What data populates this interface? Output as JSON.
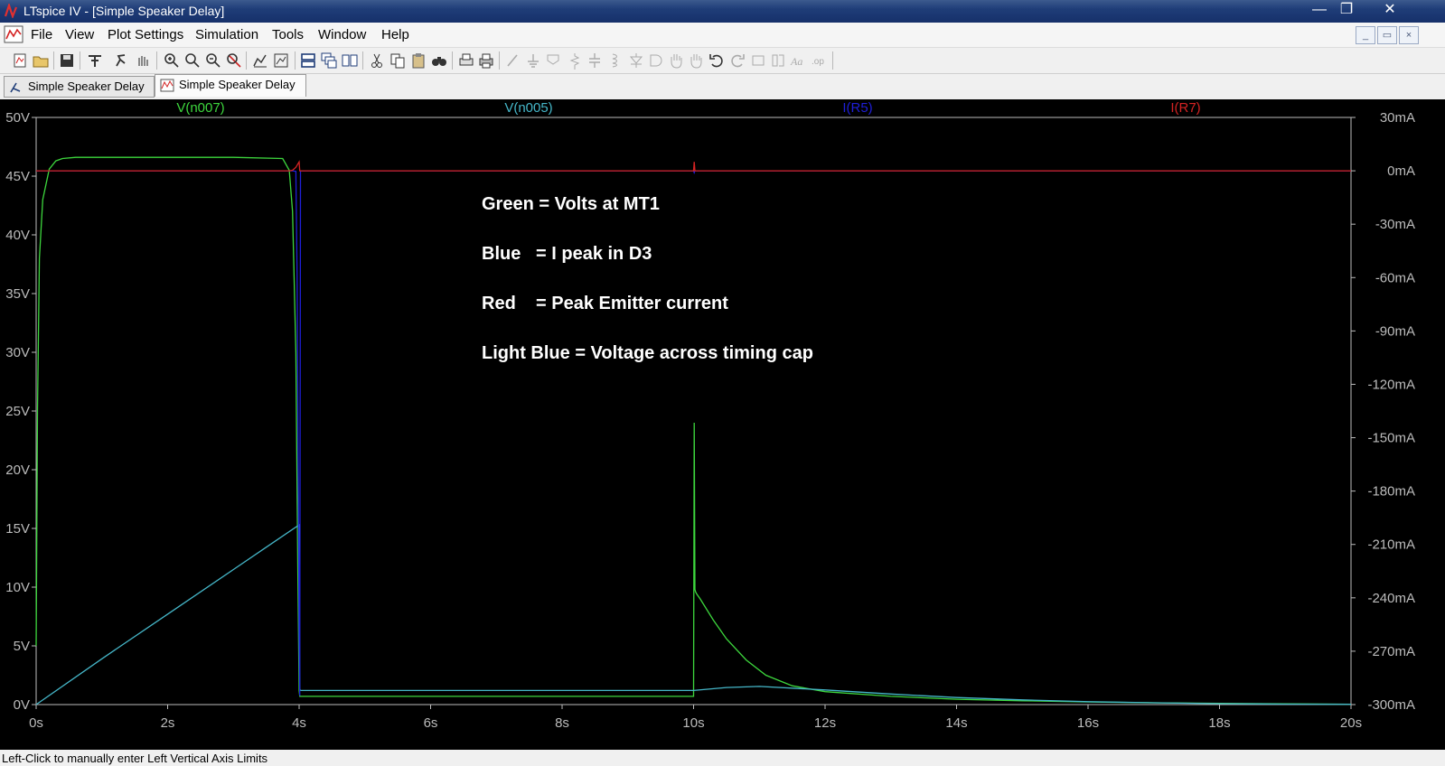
{
  "window": {
    "title": "LTspice IV - [Simple Speaker Delay]"
  },
  "menu": {
    "items": [
      "File",
      "View",
      "Plot Settings",
      "Simulation",
      "Tools",
      "Window",
      "Help"
    ]
  },
  "tabs": [
    {
      "label": "Simple Speaker Delay",
      "icon": "schematic-icon",
      "active": false
    },
    {
      "label": "Simple Speaker Delay",
      "icon": "waveform-icon",
      "active": true
    }
  ],
  "status": {
    "text": "Left-Click to manually enter Left Vertical Axis Limits"
  },
  "annotations": [
    "Green = Volts at MT1",
    "Blue   = I peak in D3",
    "Red    = Peak Emitter current",
    "Light Blue = Voltage across timing cap"
  ],
  "colors": {
    "green": "#3dd63d",
    "light_blue": "#45b6c8",
    "blue": "#1f1fd8",
    "red": "#d42323",
    "plot_background": "#000000",
    "axis": "#bcbcbc"
  },
  "chart_data": {
    "type": "line",
    "x_ticks": [
      "0s",
      "2s",
      "4s",
      "6s",
      "8s",
      "10s",
      "12s",
      "14s",
      "16s",
      "18s",
      "20s"
    ],
    "y_left_ticks": [
      "0V",
      "5V",
      "10V",
      "15V",
      "20V",
      "25V",
      "30V",
      "35V",
      "40V",
      "45V",
      "50V"
    ],
    "y_right_ticks": [
      "30mA",
      "0mA",
      "-30mA",
      "-60mA",
      "-90mA",
      "-120mA",
      "-150mA",
      "-180mA",
      "-210mA",
      "-240mA",
      "-270mA",
      "-300mA"
    ],
    "xlim": [
      0,
      20
    ],
    "ylim_left": [
      0,
      50
    ],
    "ylim_right": [
      -300,
      30
    ],
    "series": [
      {
        "name": "V(n007)",
        "axis": "left",
        "color": "#3dd63d",
        "x": [
          0,
          0.02,
          0.05,
          0.1,
          0.2,
          0.3,
          0.4,
          0.6,
          1,
          2,
          3,
          3.75,
          3.85,
          3.9,
          3.95,
          3.98,
          4.0,
          4.01,
          4.02,
          10.0,
          10.01,
          10.02,
          10.03,
          10.05,
          10.1,
          10.3,
          10.5,
          10.8,
          11.1,
          11.5,
          12,
          13,
          14,
          15,
          16,
          17,
          18,
          19,
          20
        ],
        "y": [
          5,
          25,
          38,
          43,
          45.6,
          46.3,
          46.5,
          46.6,
          46.6,
          46.6,
          46.6,
          46.5,
          45.5,
          42,
          30,
          12,
          1.2,
          0.7,
          0.7,
          0.7,
          24,
          9.8,
          9.6,
          9.4,
          9.0,
          7.2,
          5.6,
          3.8,
          2.5,
          1.6,
          1.1,
          0.7,
          0.45,
          0.32,
          0.22,
          0.15,
          0.1,
          0.06,
          0.03
        ]
      },
      {
        "name": "V(n005)",
        "axis": "left",
        "color": "#45b6c8",
        "x": [
          0,
          1,
          2,
          3,
          3.5,
          4.0,
          4.01,
          4.02,
          6,
          8,
          10,
          10.5,
          11,
          12,
          13,
          14,
          15,
          16,
          17,
          18,
          19,
          20
        ],
        "y": [
          0,
          3.9,
          7.7,
          11.5,
          13.4,
          15.3,
          1.3,
          1.2,
          1.2,
          1.2,
          1.2,
          1.45,
          1.55,
          1.25,
          0.9,
          0.6,
          0.4,
          0.25,
          0.15,
          0.08,
          0.04,
          0.02
        ]
      },
      {
        "name": "I(R5)",
        "axis": "right",
        "color": "#1f1fd8",
        "x": [
          0,
          3.9,
          3.95,
          3.97,
          4.0,
          4.01,
          4.02,
          10.0,
          10.01,
          10.02,
          20
        ],
        "y": [
          0,
          0,
          -0.3,
          -60,
          -260,
          -295,
          0,
          0,
          -1,
          0,
          0
        ]
      },
      {
        "name": "I(R7)",
        "axis": "right",
        "color": "#d42323",
        "x": [
          0,
          3.85,
          3.9,
          3.95,
          4.0,
          4.01,
          4.02,
          10.0,
          10.01,
          10.02,
          20
        ],
        "y": [
          0,
          0,
          0.3,
          2,
          5,
          0,
          0,
          0,
          5,
          0,
          0
        ]
      }
    ]
  }
}
